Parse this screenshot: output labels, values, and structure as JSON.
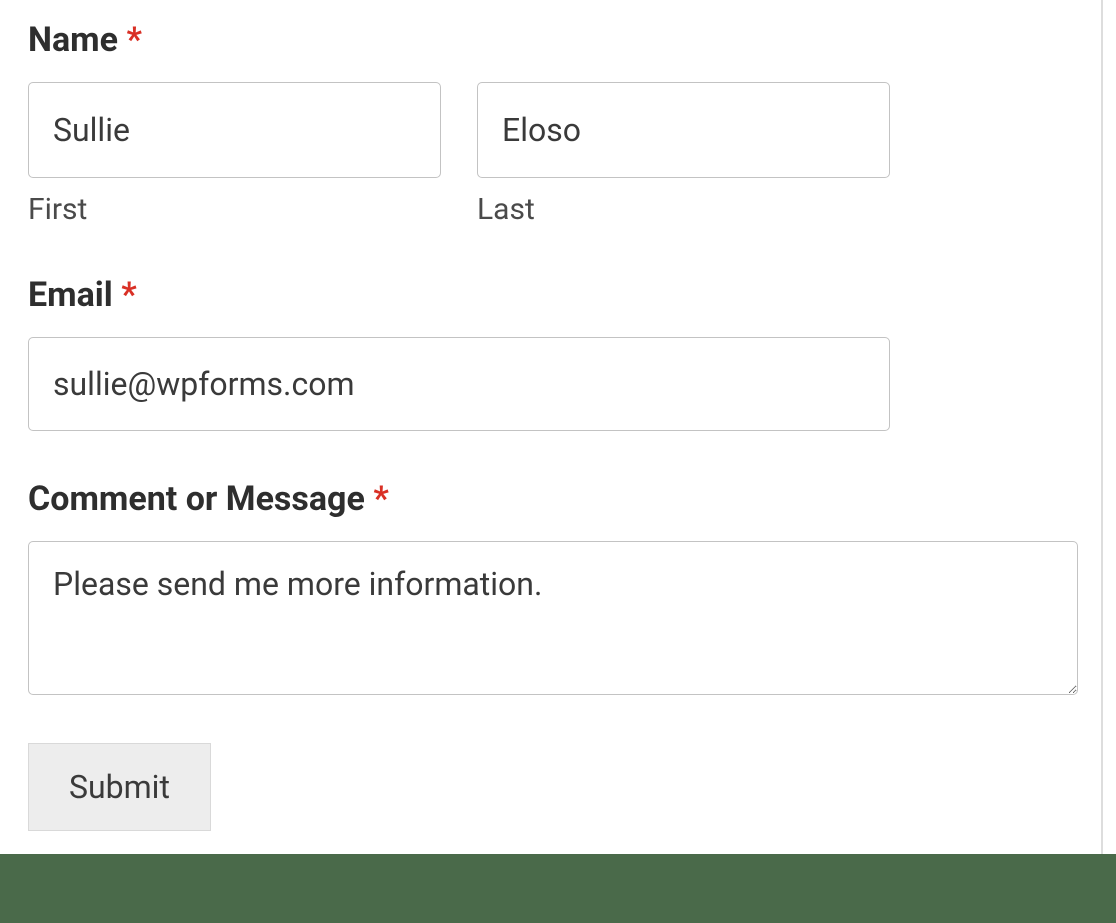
{
  "form": {
    "name": {
      "label": "Name",
      "required": "*",
      "first": {
        "value": "Sullie",
        "sublabel": "First"
      },
      "last": {
        "value": "Eloso",
        "sublabel": "Last"
      }
    },
    "email": {
      "label": "Email",
      "required": "*",
      "value": "sullie@wpforms.com"
    },
    "message": {
      "label": "Comment or Message",
      "required": "*",
      "value": "Please send me more information."
    },
    "submit": {
      "label": "Submit"
    }
  }
}
